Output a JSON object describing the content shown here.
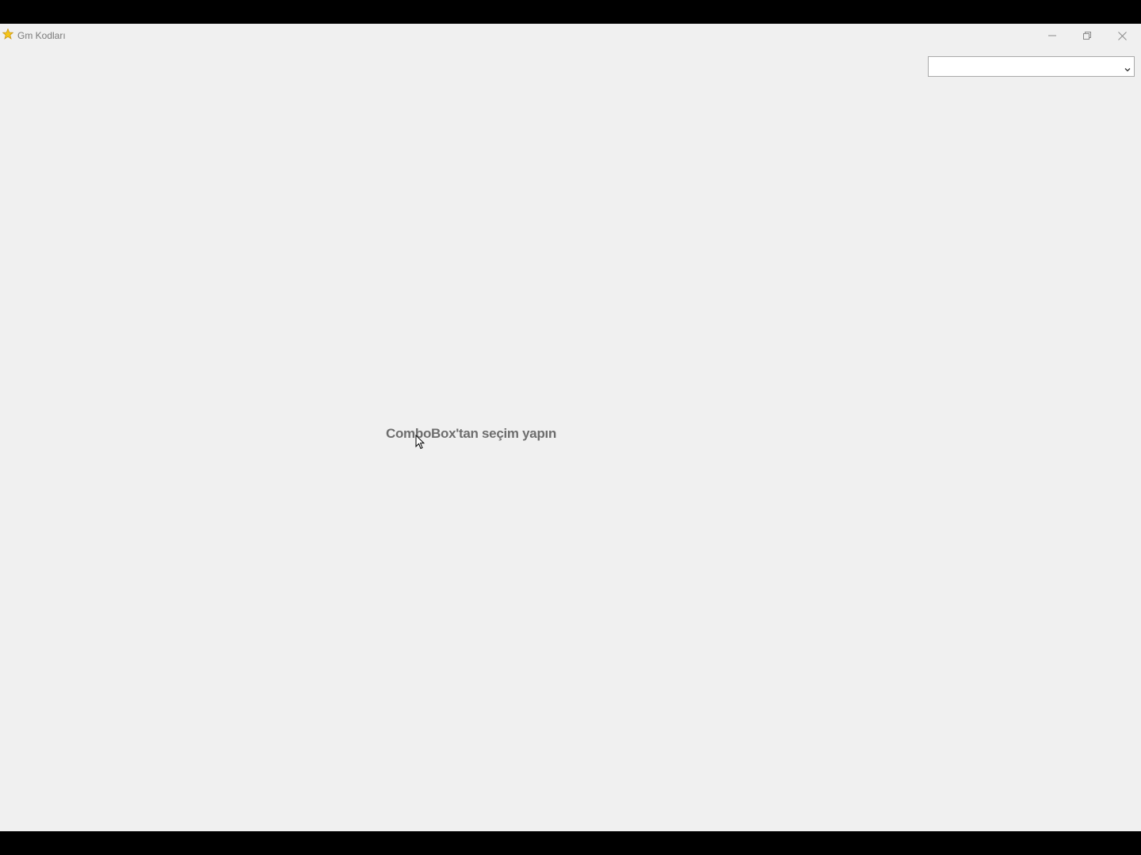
{
  "window": {
    "title": "Gm Kodları",
    "app_icon": "yellow-star-icon",
    "controls": {
      "minimize": "minimize-icon",
      "restore": "restore-icon",
      "close": "close-icon"
    }
  },
  "main": {
    "combobox": {
      "selected_value": "",
      "icon": "chevron-down-icon"
    },
    "prompt_text": "ComboBox'tan seçim yapın"
  },
  "colors": {
    "window_background": "#f0f0f0",
    "prompt_text": "#6e6e6e",
    "screen_border": "#000000"
  }
}
